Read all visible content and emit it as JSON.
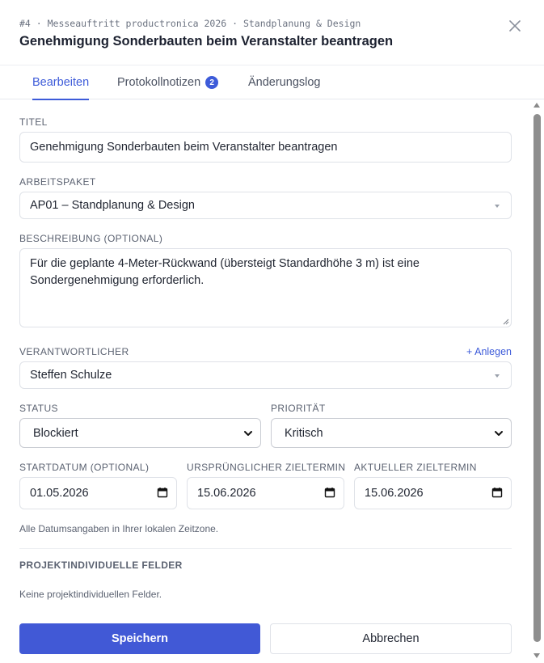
{
  "header": {
    "breadcrumb": "#4 · Messeauftritt productronica 2026 · Standplanung & Design",
    "title": "Genehmigung Sonderbauten beim Veranstalter beantragen",
    "close_icon": "close-icon"
  },
  "tabs": [
    {
      "label": "Bearbeiten",
      "active": true
    },
    {
      "label": "Protokollnotizen",
      "badge": "2"
    },
    {
      "label": "Änderungslog"
    }
  ],
  "form": {
    "title_label": "TITEL",
    "title_value": "Genehmigung Sonderbauten beim Veranstalter beantragen",
    "package_label": "ARBEITSPAKET",
    "package_value": "AP01 – Standplanung & Design",
    "description_label": "BESCHREIBUNG (OPTIONAL)",
    "description_value": "Für die geplante 4-Meter-Rückwand (übersteigt Standardhöhe 3 m) ist eine Sondergenehmigung erforderlich.",
    "owner_label": "VERANTWORTLICHER",
    "owner_add": "+ Anlegen",
    "owner_value": "Steffen Schulze",
    "status_label": "STATUS",
    "status_value": "Blockiert",
    "priority_label": "PRIORITÄT",
    "priority_value": "Kritisch",
    "start_label": "STARTDATUM (OPTIONAL)",
    "start_value": "01.05.2026",
    "original_due_label": "URSPRÜNGLICHER ZIELTERMIN",
    "original_due_value": "15.06.2026",
    "current_due_label": "AKTUELLER ZIELTERMIN",
    "current_due_value": "15.06.2026",
    "timezone_hint": "Alle Datumsangaben in Ihrer lokalen Zeitzone.",
    "custom_fields_label": "PROJEKTINDIVIDUELLE FELDER",
    "custom_fields_empty": "Keine projektindividuellen Felder."
  },
  "actions": {
    "save_label": "Speichern",
    "cancel_label": "Abbrechen"
  },
  "colors": {
    "accent": "#3d5bd9",
    "primary_button": "#4159d6"
  }
}
